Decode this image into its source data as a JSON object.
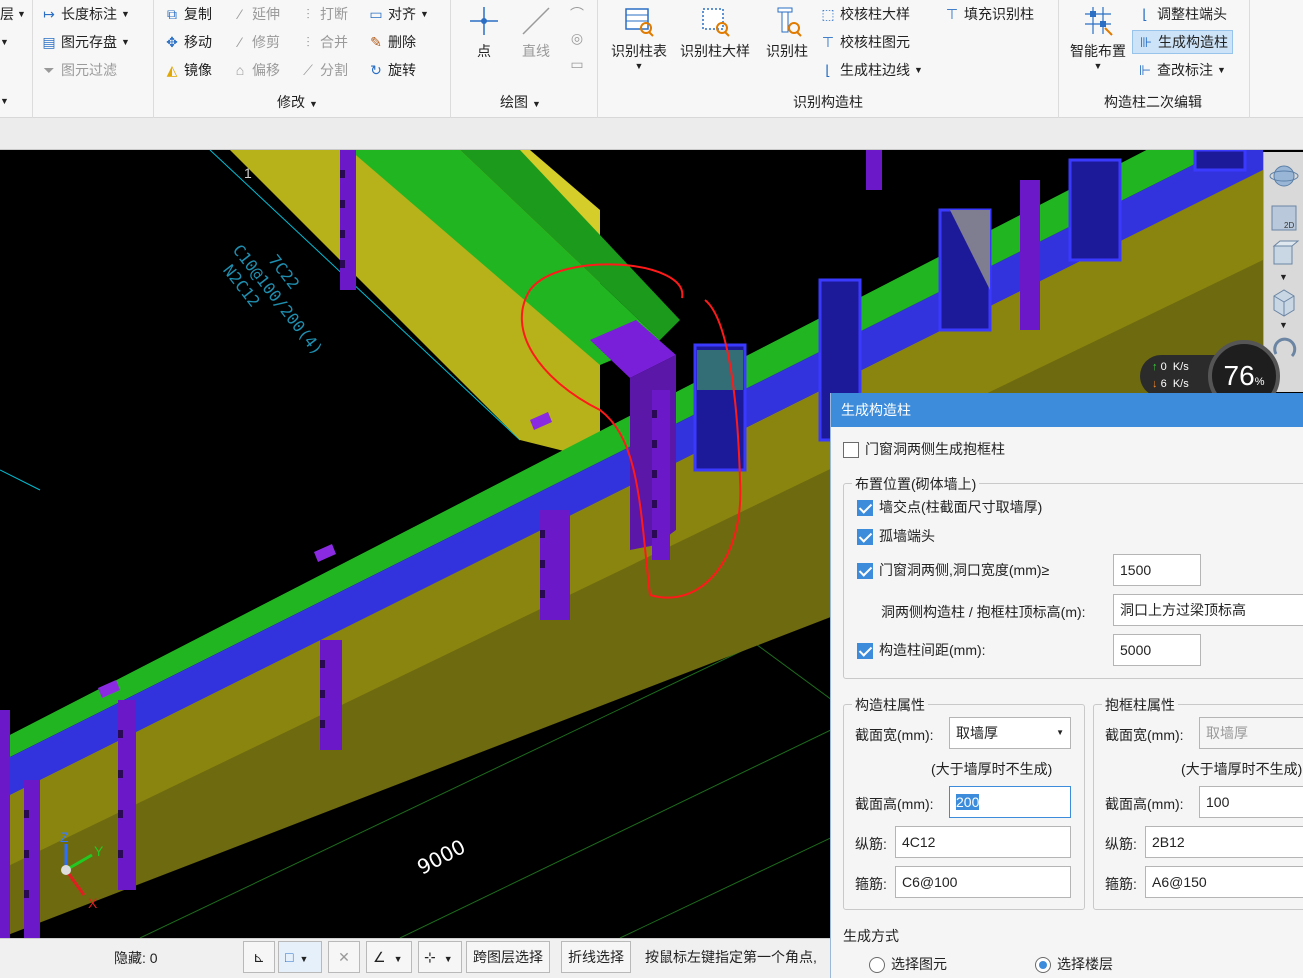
{
  "ribbon": {
    "col0": {
      "r1": "层",
      "r2": "",
      "r3": "",
      "r4": ""
    },
    "general": {
      "length_dim": "长度标注",
      "element_save": "图元存盘",
      "element_filter": "图元过滤"
    },
    "modify": {
      "copy": "复制",
      "extend": "延伸",
      "break": "打断",
      "align": "对齐",
      "move": "移动",
      "trim": "修剪",
      "merge": "合并",
      "delete": "删除",
      "mirror": "镜像",
      "offset": "偏移",
      "split": "分割",
      "rotate": "旋转",
      "title": "修改"
    },
    "draw": {
      "point": "点",
      "line": "直线",
      "title": "绘图"
    },
    "identify": {
      "col_table": "识别柱表",
      "col_detail": "识别柱大样",
      "col": "识别柱",
      "check_detail": "校核柱大样",
      "check_element": "校核柱图元",
      "gen_edge": "生成柱边线",
      "fill": "填充识别柱",
      "title": "识别构造柱"
    },
    "edit2": {
      "smart_layout": "智能布置",
      "adjust_end": "调整柱端头",
      "gen_column": "生成构造柱",
      "check_label": "查改标注",
      "title": "构造柱二次编辑"
    }
  },
  "viewport": {
    "annotation_text": "C10@100/200(4)\n7C22\nN2C12",
    "annotation_line1": "C10@100/200(4)",
    "annotation_line2": "7C22",
    "annotation_line3": "N2C12",
    "dimension": "9000",
    "small_label": "1",
    "axes": {
      "x": "X",
      "y": "Y",
      "z": "Z"
    }
  },
  "speed": {
    "up_value": "0",
    "up_unit": "K/s",
    "down_value": "6",
    "down_unit": "K/s",
    "percent": "76",
    "percent_sign": "%"
  },
  "status": {
    "hidden_label": "隐藏: 0",
    "cross_layer": "跨图层选择",
    "polyline_select": "折线选择",
    "hint": "按鼠标左键指定第一个角点,"
  },
  "dialog": {
    "title": "生成构造柱",
    "door_window_frame": "门窗洞两侧生成抱框柱",
    "door_window_frame_checked": false,
    "position_group": "布置位置(砌体墙上)",
    "wall_intersection": "墙交点(柱截面尺寸取墙厚)",
    "wall_intersection_checked": true,
    "isolated_end": "孤墙端头",
    "isolated_end_checked": true,
    "opening_sides": "门窗洞两侧,洞口宽度(mm)≥",
    "opening_sides_checked": true,
    "opening_width": "1500",
    "top_elev_label": "洞两侧构造柱 / 抱框柱顶标高(m):",
    "top_elev_value": "洞口上方过梁顶标高",
    "spacing_label": "构造柱间距(mm):",
    "spacing_checked": true,
    "spacing_value": "5000",
    "col_props": {
      "title": "构造柱属性",
      "width_label": "截面宽(mm):",
      "width_value": "取墙厚",
      "note": "(大于墙厚时不生成)",
      "height_label": "截面高(mm):",
      "height_value": "200",
      "long_bar_label": "纵筋:",
      "long_bar_value": "4C12",
      "stirrup_label": "箍筋:",
      "stirrup_value": "C6@100"
    },
    "frame_props": {
      "title": "抱框柱属性",
      "width_label": "截面宽(mm):",
      "width_value": "取墙厚",
      "note": "(大于墙厚时不生成)",
      "height_label": "截面高(mm):",
      "height_value": "100",
      "long_bar_label": "纵筋:",
      "long_bar_value": "2B12",
      "stirrup_label": "箍筋:",
      "stirrup_value": "A6@150"
    },
    "gen_mode": "生成方式",
    "opt_select_element": "选择图元",
    "opt_select_floor": "选择楼层",
    "selected_mode": "选择楼层"
  }
}
